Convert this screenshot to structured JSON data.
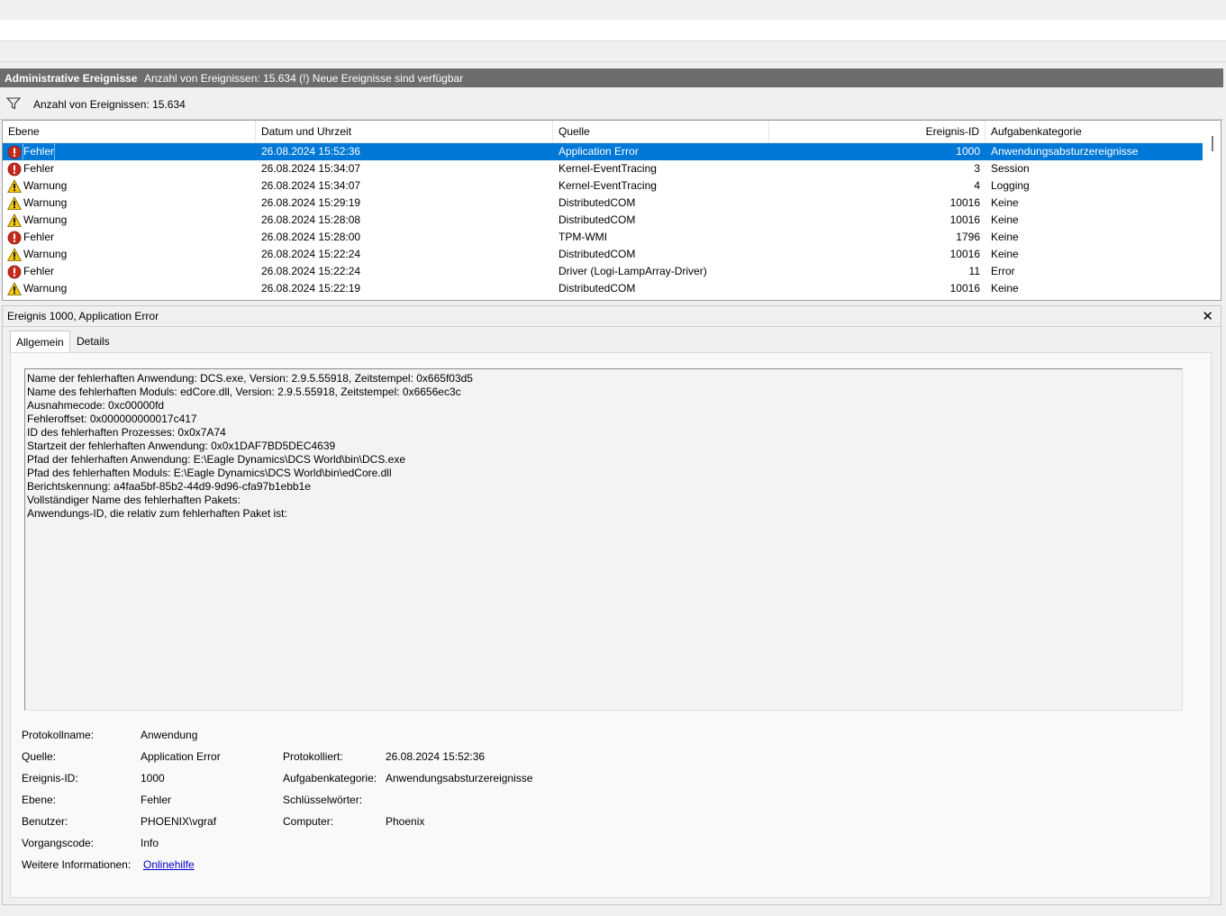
{
  "header": {
    "title": "Administrative Ereignisse",
    "status": "Anzahl von Ereignissen: 15.634 (!) Neue Ereignisse sind verfügbar"
  },
  "filter": {
    "icon": "filter-icon",
    "text": "Anzahl von Ereignissen: 15.634"
  },
  "columns": {
    "level": "Ebene",
    "date": "Datum und Uhrzeit",
    "source": "Quelle",
    "id": "Ereignis-ID",
    "category": "Aufgabenkategorie"
  },
  "events": [
    {
      "type": "error",
      "level": "Fehler",
      "date": "26.08.2024 15:52:36",
      "source": "Application Error",
      "id": "1000",
      "category": "Anwendungsabsturzereignisse",
      "selected": true
    },
    {
      "type": "error",
      "level": "Fehler",
      "date": "26.08.2024 15:34:07",
      "source": "Kernel-EventTracing",
      "id": "3",
      "category": "Session"
    },
    {
      "type": "warning",
      "level": "Warnung",
      "date": "26.08.2024 15:34:07",
      "source": "Kernel-EventTracing",
      "id": "4",
      "category": "Logging"
    },
    {
      "type": "warning",
      "level": "Warnung",
      "date": "26.08.2024 15:29:19",
      "source": "DistributedCOM",
      "id": "10016",
      "category": "Keine"
    },
    {
      "type": "warning",
      "level": "Warnung",
      "date": "26.08.2024 15:28:08",
      "source": "DistributedCOM",
      "id": "10016",
      "category": "Keine"
    },
    {
      "type": "error",
      "level": "Fehler",
      "date": "26.08.2024 15:28:00",
      "source": "TPM-WMI",
      "id": "1796",
      "category": "Keine"
    },
    {
      "type": "warning",
      "level": "Warnung",
      "date": "26.08.2024 15:22:24",
      "source": "DistributedCOM",
      "id": "10016",
      "category": "Keine"
    },
    {
      "type": "error",
      "level": "Fehler",
      "date": "26.08.2024 15:22:24",
      "source": "Driver (Logi-LampArray-Driver)",
      "id": "11",
      "category": "Error"
    },
    {
      "type": "warning",
      "level": "Warnung",
      "date": "26.08.2024 15:22:19",
      "source": "DistributedCOM",
      "id": "10016",
      "category": "Keine"
    }
  ],
  "detail": {
    "title": "Ereignis 1000, Application Error",
    "close": "✕",
    "tabs": {
      "general": "Allgemein",
      "details": "Details"
    },
    "message": [
      "Name der fehlerhaften Anwendung: DCS.exe, Version: 2.9.5.55918, Zeitstempel: 0x665f03d5",
      "Name des fehlerhaften Moduls: edCore.dll, Version: 2.9.5.55918, Zeitstempel: 0x6656ec3c",
      "Ausnahmecode: 0xc00000fd",
      "Fehleroffset: 0x000000000017c417",
      "ID des fehlerhaften Prozesses: 0x0x7A74",
      "Startzeit der fehlerhaften Anwendung: 0x0x1DAF7BD5DEC4639",
      "Pfad der fehlerhaften Anwendung: E:\\Eagle Dynamics\\DCS World\\bin\\DCS.exe",
      "Pfad des fehlerhaften Moduls: E:\\Eagle Dynamics\\DCS World\\bin\\edCore.dll",
      "Berichtskennung: a4faa5bf-85b2-44d9-9d96-cfa97b1ebb1e",
      "Vollständiger Name des fehlerhaften Pakets:",
      "Anwendungs-ID, die relativ zum fehlerhaften Paket ist:"
    ],
    "props": {
      "logname_label": "Protokollname:",
      "logname": "Anwendung",
      "source_label": "Quelle:",
      "source": "Application Error",
      "logged_label": "Protokolliert:",
      "logged": "26.08.2024 15:52:36",
      "eventid_label": "Ereignis-ID:",
      "eventid": "1000",
      "category_label": "Aufgabenkategorie:",
      "category": "Anwendungsabsturzereignisse",
      "level_label": "Ebene:",
      "level": "Fehler",
      "keywords_label": "Schlüsselwörter:",
      "keywords": "",
      "user_label": "Benutzer:",
      "user": "PHOENIX\\vgraf",
      "computer_label": "Computer:",
      "computer": "Phoenix",
      "opcode_label": "Vorgangscode:",
      "opcode": "Info",
      "moreinfo_label": "Weitere Informationen:",
      "moreinfo_link": "Onlinehilfe"
    }
  }
}
